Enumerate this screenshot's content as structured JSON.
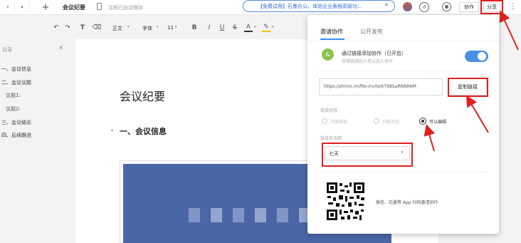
{
  "topbar": {
    "title": "会议纪要",
    "autosave": "文档已自动保存",
    "banner": "【免费试用】石墨办公，体验企业表格高级功...",
    "collaborate": "协作",
    "share": "分享"
  },
  "toolbar": {
    "text_style": "正文",
    "font_family": "字体",
    "font_size": "11"
  },
  "sidebar": {
    "title": "目录",
    "items": [
      "一、会议信息",
      "二、会议议题",
      "议题1:",
      "议题2:",
      "三、会议结论",
      "四、后续跟进"
    ]
  },
  "document": {
    "title": "会议纪要",
    "heading1": "一、会议信息"
  },
  "panel": {
    "tabs": [
      "邀请协作",
      "公开发布"
    ],
    "link_toggle_title": "通过链接添加协作（已开启）",
    "link_toggle_desc": "获得链接的人可以加入协作",
    "link_url": "https://shimo.im/file-invite/kT9BSaRNNRAM",
    "copy_button": "复制链接",
    "permission_label": "链接权限",
    "permissions": [
      "只能阅读",
      "只能评论",
      "可以编辑"
    ],
    "selected_permission": "可以编辑",
    "validity_label": "链接有效期",
    "validity_value": "七天",
    "qr_caption": "微信、石墨等 App 扫码邀请协作"
  },
  "colors": {
    "accent": "#3b8af5",
    "toggle": "#4a90e2",
    "annotation": "#e02020",
    "image_block": "#4a66a6"
  }
}
